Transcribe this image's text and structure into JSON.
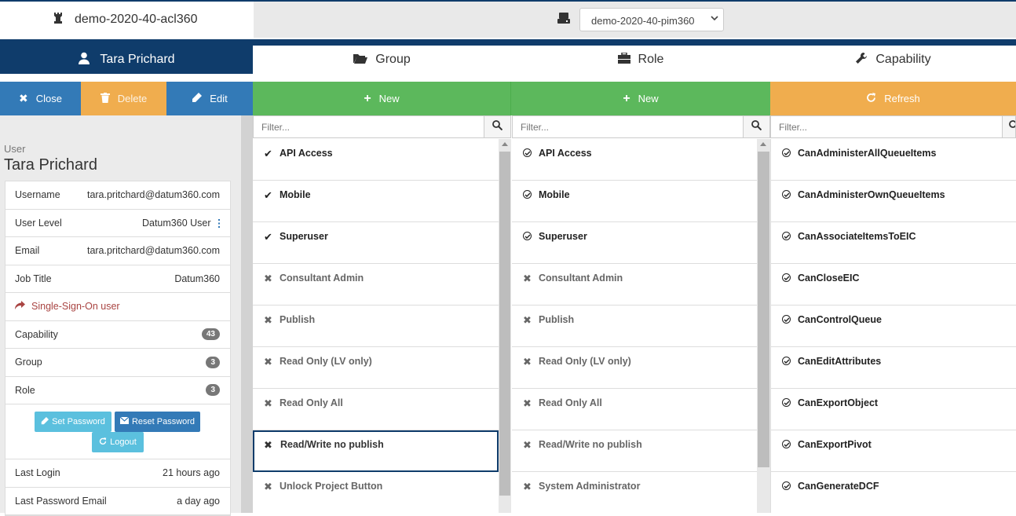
{
  "header": {
    "app_name": "demo-2020-40-acl360",
    "db_select": "demo-2020-40-pim360"
  },
  "nav": {
    "user": "Tara Prichard",
    "tabs": [
      "Group",
      "Role",
      "Capability"
    ]
  },
  "actions": {
    "close": "Close",
    "delete": "Delete",
    "edit": "Edit",
    "new_group": "New",
    "new_role": "New",
    "refresh": "Refresh"
  },
  "colors": {
    "navy": "#0f3c6b",
    "close_btn": "#337ab7",
    "delete_btn": "#f0ad4e",
    "edit_btn": "#337ab7",
    "new_btn": "#5cb85c",
    "refresh_btn": "#f0ad4e",
    "sso_text": "#a94442"
  },
  "user": {
    "caption": "User",
    "name": "Tara Prichard",
    "fields": [
      {
        "label": "Username",
        "value": "tara.pritchard@datum360.com"
      },
      {
        "label": "User Level",
        "value": "Datum360 User"
      },
      {
        "label": "Email",
        "value": "tara.pritchard@datum360.com"
      },
      {
        "label": "Job Title",
        "value": "Datum360"
      }
    ],
    "sso": "Single-Sign-On user",
    "counts": [
      {
        "label": "Capability",
        "value": "43"
      },
      {
        "label": "Group",
        "value": "3"
      },
      {
        "label": "Role",
        "value": "3"
      }
    ],
    "buttons": {
      "set_password": "Set Password",
      "reset_password": "Reset Password",
      "logout": "Logout"
    },
    "last": [
      {
        "label": "Last Login",
        "value": "21 hours ago"
      },
      {
        "label": "Last Password Email",
        "value": "a day ago"
      }
    ]
  },
  "filter_placeholder": "Filter...",
  "groups": [
    {
      "name": "API Access",
      "on": true
    },
    {
      "name": "Mobile",
      "on": true
    },
    {
      "name": "Superuser",
      "on": true
    },
    {
      "name": "Consultant Admin",
      "on": false
    },
    {
      "name": "Publish",
      "on": false
    },
    {
      "name": "Read Only (LV only)",
      "on": false
    },
    {
      "name": "Read Only All",
      "on": false
    },
    {
      "name": "Read/Write no publish",
      "on": false
    },
    {
      "name": "Unlock Project Button",
      "on": false
    }
  ],
  "roles": [
    {
      "name": "API Access",
      "on": true
    },
    {
      "name": "Mobile",
      "on": true
    },
    {
      "name": "Superuser",
      "on": true
    },
    {
      "name": "Consultant Admin",
      "on": false
    },
    {
      "name": "Publish",
      "on": false
    },
    {
      "name": "Read Only (LV only)",
      "on": false
    },
    {
      "name": "Read Only All",
      "on": false
    },
    {
      "name": "Read/Write no publish",
      "on": false
    },
    {
      "name": "System Administrator",
      "on": false
    }
  ],
  "capabilities": [
    "CanAdministerAllQueueItems",
    "CanAdministerOwnQueueItems",
    "CanAssociateItemsToEIC",
    "CanCloseEIC",
    "CanControlQueue",
    "CanEditAttributes",
    "CanExportObject",
    "CanExportPivot",
    "CanGenerateDCF"
  ]
}
